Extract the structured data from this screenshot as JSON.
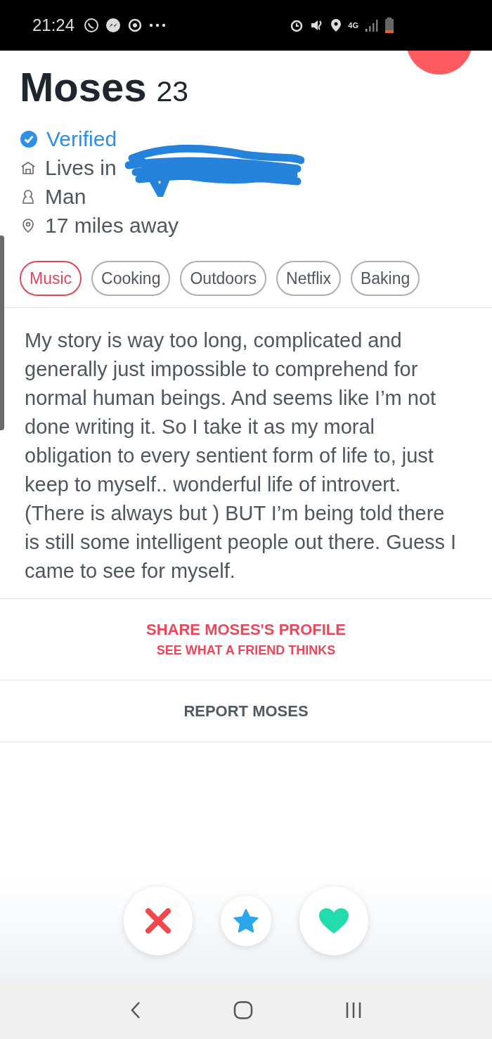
{
  "status_bar": {
    "time": "21:24",
    "network": "4G"
  },
  "profile": {
    "name": "Moses",
    "age": "23",
    "verified": "Verified",
    "lives_in": "Lives in",
    "gender": "Man",
    "distance": "17 miles away"
  },
  "interests": [
    {
      "label": "Music",
      "selected": true
    },
    {
      "label": "Cooking",
      "selected": false
    },
    {
      "label": "Outdoors",
      "selected": false
    },
    {
      "label": "Netflix",
      "selected": false
    },
    {
      "label": "Baking",
      "selected": false
    }
  ],
  "bio": [
    "My story is way too long, complicated  and generally just impossible to comprehend for normal human beings. And seems like I’m not done writing it. So I take it as my moral obligation to every sentient form of life to, just keep to myself.. wonderful life of introvert.",
    "(There is always but ) BUT I’m being told there is still some intelligent people out there. Guess I came to see for myself."
  ],
  "share": {
    "title": "SHARE MOSES'S PROFILE",
    "subtitle": "SEE WHAT A FRIEND THINKS"
  },
  "report": "REPORT MOSES"
}
